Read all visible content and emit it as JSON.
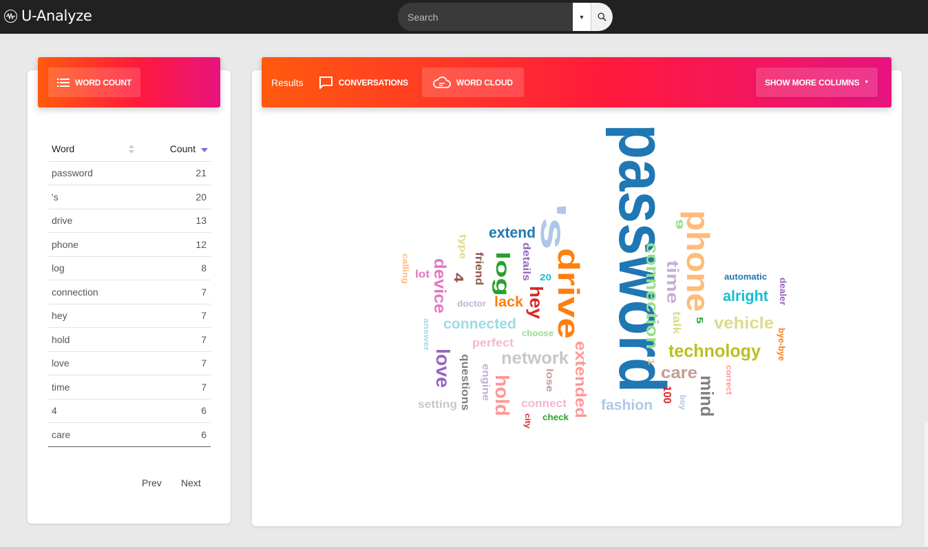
{
  "app": {
    "title": "U-Analyze"
  },
  "search": {
    "placeholder": "Search"
  },
  "left_panel": {
    "word_count_tab": "WORD COUNT",
    "table": {
      "headers": [
        "Word",
        "Count"
      ],
      "rows": [
        {
          "word": "password",
          "count": "21"
        },
        {
          "word": "'s",
          "count": "20"
        },
        {
          "word": "drive",
          "count": "13"
        },
        {
          "word": "phone",
          "count": "12"
        },
        {
          "word": "log",
          "count": "8"
        },
        {
          "word": "connection",
          "count": "7"
        },
        {
          "word": "hey",
          "count": "7"
        },
        {
          "word": "hold",
          "count": "7"
        },
        {
          "word": "love",
          "count": "7"
        },
        {
          "word": "time",
          "count": "7"
        },
        {
          "word": "4",
          "count": "6"
        },
        {
          "word": "care",
          "count": "6"
        }
      ]
    },
    "pager": {
      "prev": "Prev",
      "next": "Next"
    }
  },
  "right_panel": {
    "results_label": "Results",
    "conversations_tab": "CONVERSATIONS",
    "word_cloud_tab": "WORD CLOUD",
    "more_columns_label": "SHOW MORE COLUMNS"
  },
  "word_cloud": [
    {
      "text": "password",
      "color": "#1f77b4"
    },
    {
      "text": "'s",
      "color": "#aec7e8"
    },
    {
      "text": "drive",
      "color": "#ff7f0e"
    },
    {
      "text": "phone",
      "color": "#ffbb78"
    },
    {
      "text": "extend",
      "color": "#1f77b4"
    },
    {
      "text": "log",
      "color": "#2ca02c"
    },
    {
      "text": "connection",
      "color": "#98df8a"
    },
    {
      "text": "time",
      "color": "#c5b0d5"
    },
    {
      "text": "hey",
      "color": "#d62728"
    },
    {
      "text": "extended",
      "color": "#ff9896"
    },
    {
      "text": "lack",
      "color": "#ff7f0e"
    },
    {
      "text": "device",
      "color": "#e377c2"
    },
    {
      "text": "4",
      "color": "#8c564b"
    },
    {
      "text": "lot",
      "color": "#e377c2"
    },
    {
      "text": "calling",
      "color": "#ffbb78"
    },
    {
      "text": "type",
      "color": "#dbdb8d"
    },
    {
      "text": "friend",
      "color": "#8c564b"
    },
    {
      "text": "details",
      "color": "#9467bd"
    },
    {
      "text": "20",
      "color": "#17becf"
    },
    {
      "text": "doctor",
      "color": "#c5b0d5"
    },
    {
      "text": "connected",
      "color": "#9edae5"
    },
    {
      "text": "answer",
      "color": "#9edae5"
    },
    {
      "text": "perfect",
      "color": "#f7b6d2"
    },
    {
      "text": "choose",
      "color": "#98df8a"
    },
    {
      "text": "love",
      "color": "#9467bd"
    },
    {
      "text": "network",
      "color": "#c7c7c7"
    },
    {
      "text": "questions",
      "color": "#7f7f7f"
    },
    {
      "text": "engine",
      "color": "#c5b0d5"
    },
    {
      "text": "hold",
      "color": "#ff9896"
    },
    {
      "text": "lose",
      "color": "#c49c94"
    },
    {
      "text": "setting",
      "color": "#c7c7c7"
    },
    {
      "text": "connect",
      "color": "#f7b6d2"
    },
    {
      "text": "city",
      "color": "#d62728"
    },
    {
      "text": "check",
      "color": "#2ca02c"
    },
    {
      "text": "fashion",
      "color": "#aec7e8"
    },
    {
      "text": "1",
      "color": "#ffbb78"
    },
    {
      "text": "9",
      "color": "#98df8a"
    },
    {
      "text": "alright",
      "color": "#17becf"
    },
    {
      "text": "automatic",
      "color": "#1f77b4"
    },
    {
      "text": "dealer",
      "color": "#9467bd"
    },
    {
      "text": "talk",
      "color": "#dbdb8d"
    },
    {
      "text": "5",
      "color": "#2ca02c"
    },
    {
      "text": "vehicle",
      "color": "#dbdb8d"
    },
    {
      "text": "bye-bye",
      "color": "#ff7f0e"
    },
    {
      "text": "technology",
      "color": "#bcbd22"
    },
    {
      "text": "care",
      "color": "#c49c94"
    },
    {
      "text": "100",
      "color": "#d62728"
    },
    {
      "text": "boy",
      "color": "#aec7e8"
    },
    {
      "text": "mind",
      "color": "#7f7f7f"
    },
    {
      "text": "correct",
      "color": "#ff9896"
    }
  ]
}
